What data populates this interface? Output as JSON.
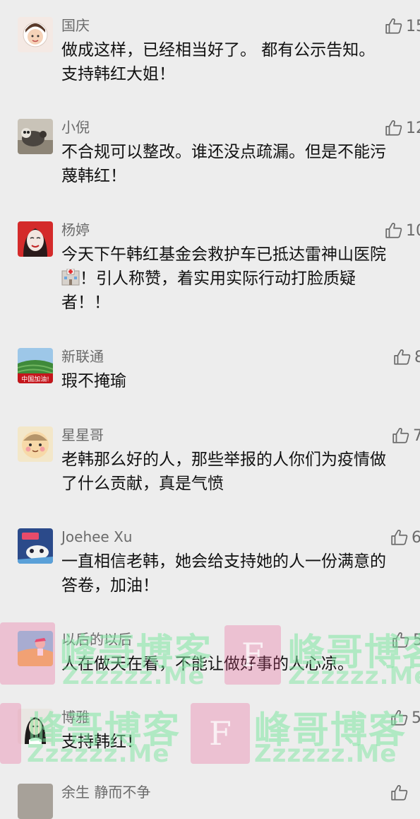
{
  "comments": [
    {
      "name": "国庆",
      "likes": "15",
      "text": "做成这样，已经相当好了。 都有公示告知。\n支持韩红大姐！"
    },
    {
      "name": "小倪",
      "likes": "12",
      "text": "不合规可以整改。谁还没点疏漏。但是不能污\n蔑韩红！"
    },
    {
      "name": "杨婷",
      "likes": "10",
      "text_before": "今天下午韩红基金会救护车已抵达雷神山医院\n",
      "text_after": "！引人称赞，着实用实际行动打脸质疑\n者！！",
      "emoji": "hospital-emoji"
    },
    {
      "name": "新联通",
      "likes": "8",
      "text": "瑕不掩瑜",
      "avatar_label": "中国加油!"
    },
    {
      "name": "星星哥",
      "likes": "7",
      "text": "老韩那么好的人，那些举报的人你们为疫情做\n了什么贡献，真是气愤"
    },
    {
      "name": "Joehee Xu",
      "likes": "6",
      "text": "一直相信老韩，她会给支持她的人一份满意的\n答卷，加油！"
    },
    {
      "name": "以后的以后",
      "likes": "5",
      "text": "人在做天在看，不能让做好事的人心凉。"
    },
    {
      "name": "博雅",
      "likes": "5",
      "text": "支持韩红！"
    },
    {
      "name": "余生 静而不争",
      "likes": "",
      "text": ""
    }
  ],
  "watermark": {
    "title": "峰哥博客",
    "domain": "Zzzzzz.Me",
    "letter": "F"
  },
  "colors": {
    "background": "#ededed",
    "name": "#6b6b6b",
    "text": "#111111",
    "watermark_pink": "#e8508c",
    "watermark_green": "#7de6a0"
  }
}
